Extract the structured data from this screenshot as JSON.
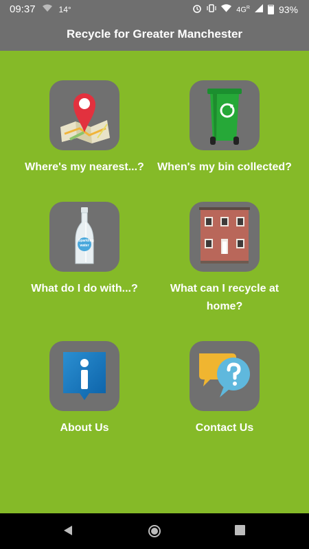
{
  "status_bar": {
    "time": "09:37",
    "temperature": "14°",
    "network": "4G",
    "network_superscript": "R",
    "battery": "93%"
  },
  "app_bar": {
    "title": "Recycle for Greater Manchester"
  },
  "tiles": [
    {
      "label": "Where's my nearest...?",
      "icon": "map-pin-icon"
    },
    {
      "label": "When's my bin collected?",
      "icon": "wheelie-bin-icon"
    },
    {
      "label": "What do I do with...?",
      "icon": "bottle-icon"
    },
    {
      "label": "What can I recycle at home?",
      "icon": "house-icon"
    },
    {
      "label": "About Us",
      "icon": "info-icon"
    },
    {
      "label": "Contact Us",
      "icon": "chat-question-icon"
    }
  ],
  "bottle_label": "Sparkling water",
  "colors": {
    "background": "#85ba28",
    "bar": "#6f6f6f",
    "tile": "#707070",
    "text": "#ffffff"
  },
  "nav_bar": {
    "buttons": [
      "back-icon",
      "home-icon",
      "recents-icon"
    ]
  }
}
